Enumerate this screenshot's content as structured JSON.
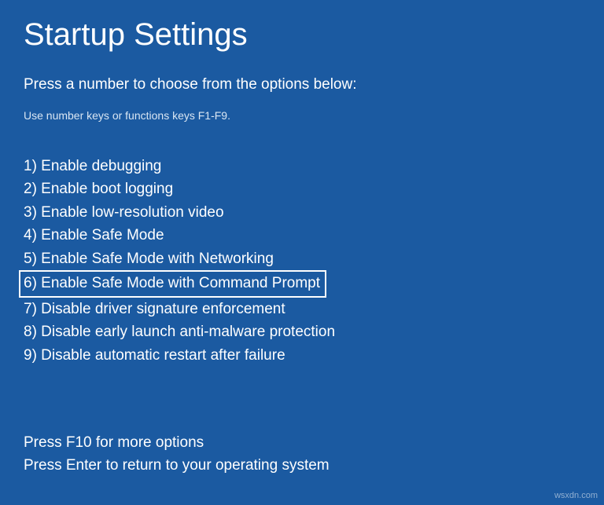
{
  "title": "Startup Settings",
  "subtitle": "Press a number to choose from the options below:",
  "hint": "Use number keys or functions keys F1-F9.",
  "options": [
    {
      "num": "1",
      "label": "Enable debugging",
      "highlighted": false
    },
    {
      "num": "2",
      "label": "Enable boot logging",
      "highlighted": false
    },
    {
      "num": "3",
      "label": "Enable low-resolution video",
      "highlighted": false
    },
    {
      "num": "4",
      "label": "Enable Safe Mode",
      "highlighted": false
    },
    {
      "num": "5",
      "label": "Enable Safe Mode with Networking",
      "highlighted": false
    },
    {
      "num": "6",
      "label": "Enable Safe Mode with Command Prompt",
      "highlighted": true
    },
    {
      "num": "7",
      "label": "Disable driver signature enforcement",
      "highlighted": false
    },
    {
      "num": "8",
      "label": "Disable early launch anti-malware protection",
      "highlighted": false
    },
    {
      "num": "9",
      "label": "Disable automatic restart after failure",
      "highlighted": false
    }
  ],
  "footer": {
    "line1": "Press F10 for more options",
    "line2": "Press Enter to return to your operating system"
  },
  "watermark": "wsxdn.com"
}
